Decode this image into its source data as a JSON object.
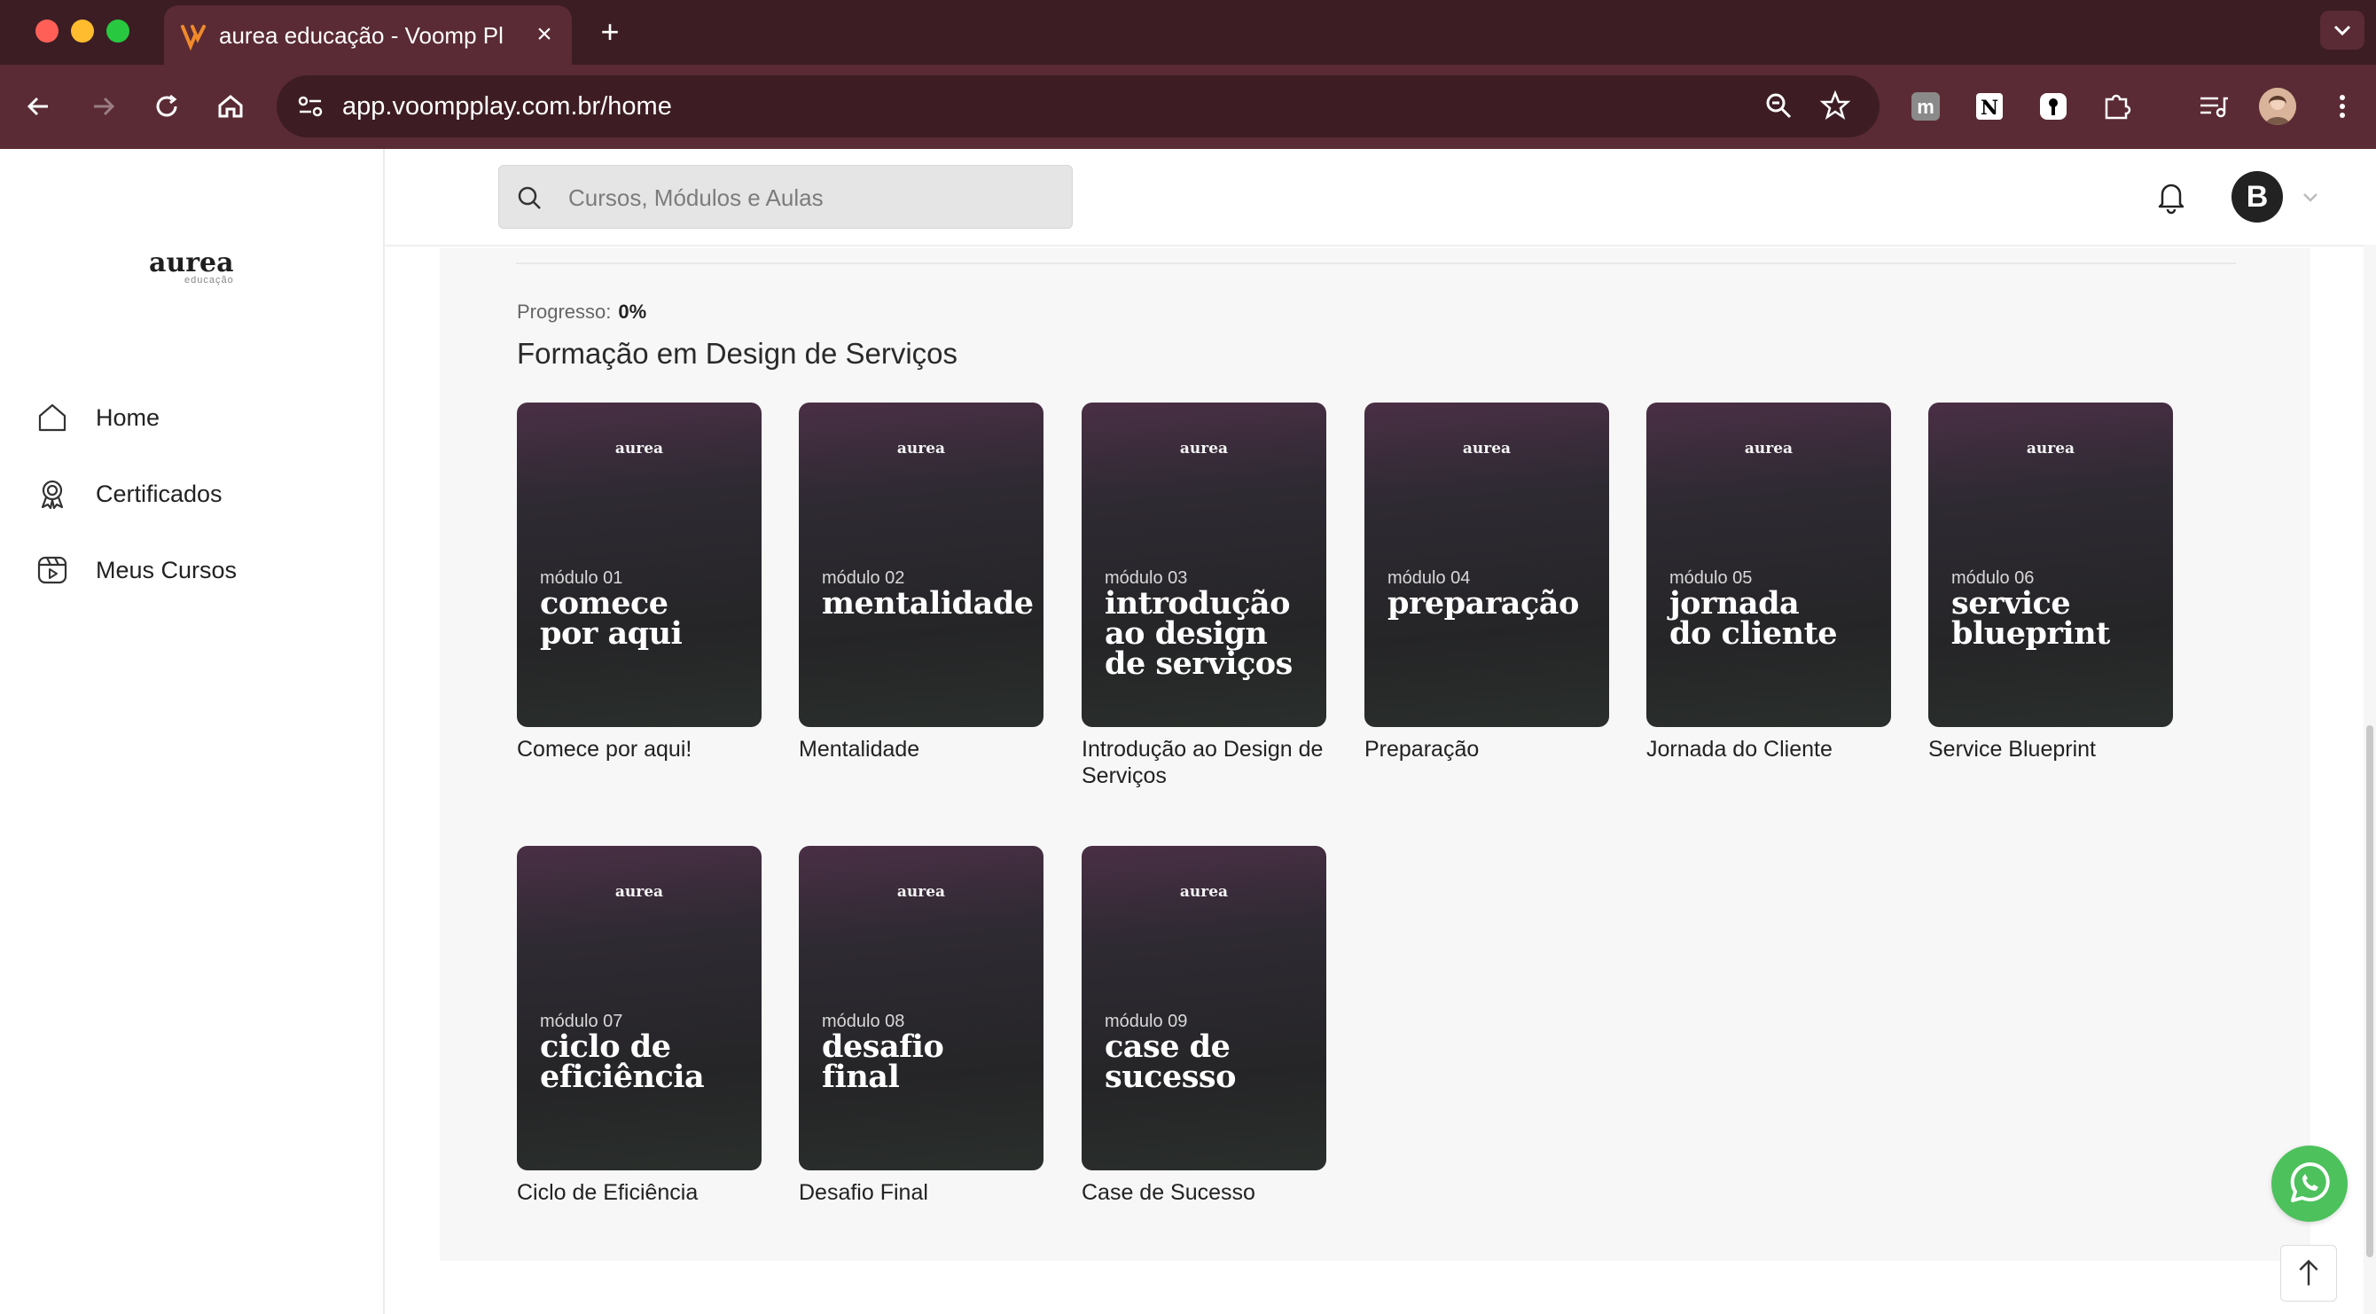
{
  "browser": {
    "tab_title": "aurea educação - Voomp Play",
    "url": "app.voompplay.com.br/home"
  },
  "sidebar": {
    "logo_text": "aurea",
    "logo_subtext": "educação",
    "items": [
      {
        "label": "Home",
        "icon": "home-icon"
      },
      {
        "label": "Certificados",
        "icon": "certificate-icon"
      },
      {
        "label": "Meus Cursos",
        "icon": "courses-icon"
      }
    ]
  },
  "header": {
    "search_placeholder": "Cursos, Módulos e Aulas",
    "user_initial": "B"
  },
  "course": {
    "progress_label": "Progresso:",
    "progress_value": "0%",
    "progress": 0,
    "title": "Formação em Design de Serviços",
    "modules": [
      {
        "thumb_logo": "aurea",
        "number": "módulo 01",
        "thumb_title": "comece\npor aqui",
        "label": "Comece por aqui!"
      },
      {
        "thumb_logo": "aurea",
        "number": "módulo 02",
        "thumb_title": "mentalidade",
        "label": "Mentalidade"
      },
      {
        "thumb_logo": "aurea",
        "number": "módulo 03",
        "thumb_title": "introdução\nao design\nde serviços",
        "label": "Introdução ao Design de Serviços"
      },
      {
        "thumb_logo": "aurea",
        "number": "módulo 04",
        "thumb_title": "preparação",
        "label": "Preparação"
      },
      {
        "thumb_logo": "aurea",
        "number": "módulo 05",
        "thumb_title": "jornada\ndo cliente",
        "label": "Jornada do Cliente"
      },
      {
        "thumb_logo": "aurea",
        "number": "módulo 06",
        "thumb_title": "service\nblueprint",
        "label": "Service Blueprint"
      },
      {
        "thumb_logo": "aurea",
        "number": "módulo 07",
        "thumb_title": "ciclo de\neficiência",
        "label": "Ciclo de Eficiência"
      },
      {
        "thumb_logo": "aurea",
        "number": "módulo 08",
        "thumb_title": "desafio\nfinal",
        "label": "Desafio Final"
      },
      {
        "thumb_logo": "aurea",
        "number": "módulo 09",
        "thumb_title": "case de\nsucesso",
        "label": "Case de Sucesso"
      }
    ]
  },
  "colors": {
    "chrome_tabbar": "#3b1d23",
    "chrome_toolbar": "#5a2b34",
    "whatsapp": "#4cc15c"
  }
}
